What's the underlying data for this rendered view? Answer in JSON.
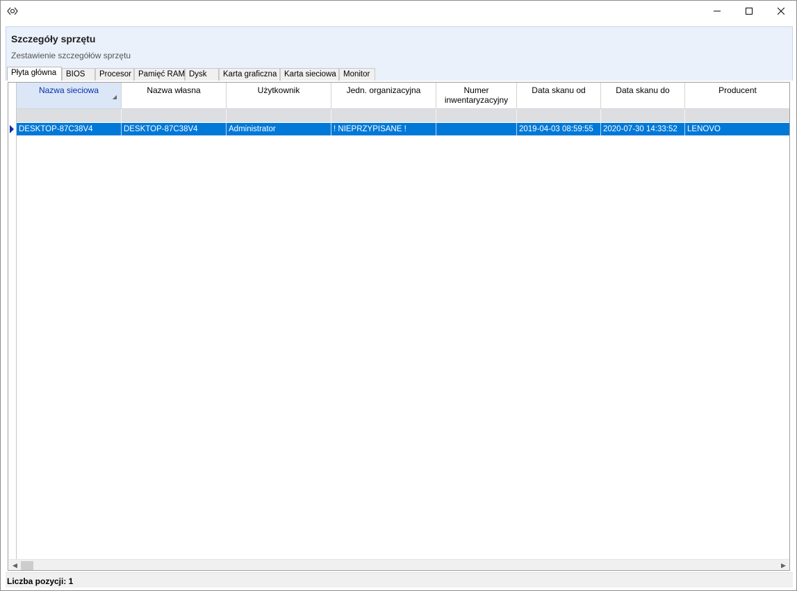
{
  "window": {
    "icon": "app-logo-icon",
    "controls": {
      "minimize": "minimize-icon",
      "maximize": "maximize-icon",
      "close": "close-icon"
    }
  },
  "header": {
    "title": "Szczegóły sprzętu",
    "subtitle": "Zestawienie szczegółów sprzętu"
  },
  "tabs": [
    {
      "label": "Płyta główna",
      "active": true
    },
    {
      "label": "BIOS"
    },
    {
      "label": "Procesor"
    },
    {
      "label": "Pamięć RAM"
    },
    {
      "label": "Dysk"
    },
    {
      "label": "Karta graficzna"
    },
    {
      "label": "Karta sieciowa"
    },
    {
      "label": "Monitor"
    }
  ],
  "grid": {
    "columns": [
      "Nazwa sieciowa",
      "Nazwa własna",
      "Użytkownik",
      "Jedn. organizacyjna",
      "Numer inwentaryzacyjny",
      "Data skanu od",
      "Data skanu do",
      "Producent"
    ],
    "sorted_column": "Nazwa sieciowa",
    "rows": [
      [
        "DESKTOP-87C38V4",
        "DESKTOP-87C38V4",
        "Administrator",
        "! NIEPRZYPISANE !",
        "",
        "2019-04-03 08:59:55",
        "2020-07-30 14:33:52",
        "LENOVO"
      ]
    ],
    "selected_row": 0,
    "selection_color": "#0078d7"
  },
  "status": {
    "text": "Liczba pozycji: 1"
  },
  "colors": {
    "header_bg": "#eaf1fb",
    "sorted_header_text": "#0a2ea8"
  }
}
